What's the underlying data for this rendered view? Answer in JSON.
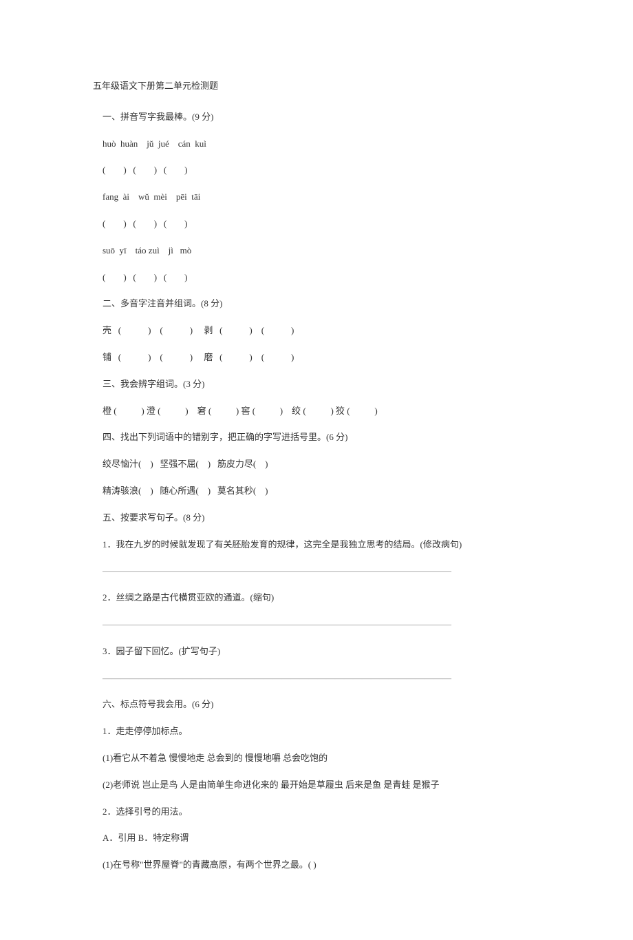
{
  "title": "五年级语文下册第二单元检测题",
  "s1": {
    "heading": "一、拼音写字我最棒。(9 分)",
    "p1": "huò  huàn    jǔ  jué    cán  kuì",
    "p2": "(        )   (        )   (        )",
    "p3": "fang  ài    wǔ  mèi    pēi  tāi",
    "p4": "(        )   (        )   (        )",
    "p5": "suō  yī    táo zuì    jì   mò",
    "p6": "(        )   (        )   (        )"
  },
  "s2": {
    "heading": "二、多音字注音并组词。(8 分)",
    "l1": "壳   (            )    (            )     剥   (            )    (            )",
    "l2": "铺   (            )    (            )     磨   (            )    (            )"
  },
  "s3": {
    "heading": "三、我会辨字组词。(3 分)",
    "l1": "橙 (           ) 澄 (           )    窘 (           ) 窖 (           )    绞 (           ) 狡 (           )"
  },
  "s4": {
    "heading": "四、找出下列词语中的错别字，把正确的字写进括号里。(6 分)",
    "l1": "绞尽恼汁(    )   坚强不屈(    )   筋皮力尽(    )",
    "l2": "精涛骇浪(    )   随心所遇(    )   莫名其秒(    )"
  },
  "s5": {
    "heading": "五、按要求写句子。(8 分)",
    "q1": "1．我在九岁的时候就发现了有关胚胎发育的规律，这完全是我独立思考的结局。(修改病句)",
    "blank": "———————————————————————————————————————",
    "q2": "2．丝绸之路是古代横贯亚欧的通道。(缩句)",
    "q3": "3．园子留下回忆。(扩写句子)"
  },
  "s6": {
    "heading": "六、标点符号我会用。(6 分)",
    "q1": "1．走走停停加标点。",
    "q1a": "(1)看它从不着急   慢慢地走   总会到的   慢慢地嚼   总会吃饱的",
    "q1b": "(2)老师说   岂止是鸟   人是由简单生命进化来的   最开始是草履虫   后来是鱼   是青蛙   是猴子",
    "q2": "2．选择引号的用法。",
    "q2opts": "A．引用     B．特定称谓",
    "q2a": "(1)在号称\"世界屋脊\"的青藏高原，有两个世界之最。(         )"
  }
}
